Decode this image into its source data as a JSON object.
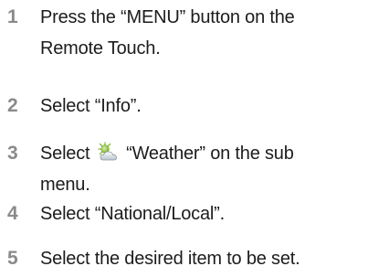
{
  "steps": [
    {
      "number": "1",
      "lines": [
        "Press the “MENU” button on the",
        "Remote Touch."
      ]
    },
    {
      "number": "2",
      "lines": [
        "Select “Info”."
      ]
    },
    {
      "number": "3",
      "before_icon": "Select",
      "icon": "weather-icon",
      "after_icon": "“Weather” on the sub",
      "lines": [
        "menu."
      ]
    },
    {
      "number": "4",
      "lines": [
        "Select “National/Local”."
      ]
    },
    {
      "number": "5",
      "lines": [
        "Select the desired item to be set."
      ]
    }
  ]
}
